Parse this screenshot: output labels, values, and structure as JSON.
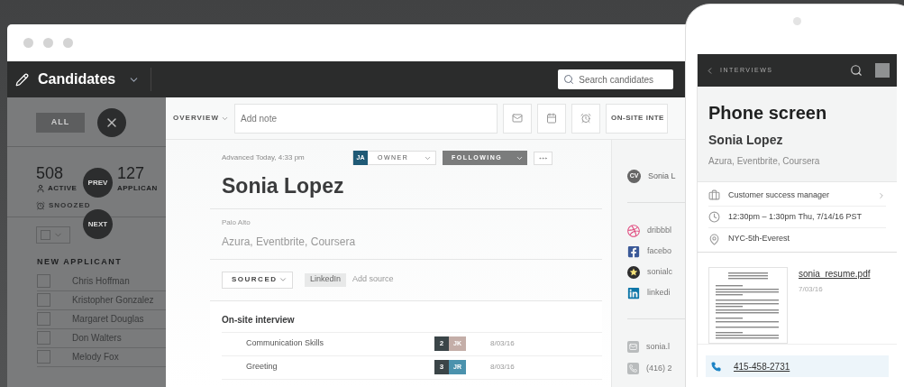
{
  "header": {
    "title": "Candidates",
    "search": {
      "placeholder": "Search candidates"
    }
  },
  "list_panel": {
    "filters": [
      {
        "label": "ALL",
        "selected": true
      }
    ],
    "stats": [
      {
        "count": "508",
        "label": "ACTIVE",
        "kind": "person"
      },
      {
        "count": "127",
        "label": "APPLICAN",
        "kind": "plain"
      }
    ],
    "snoozed": "SNOOZED",
    "section": "NEW APPLICANT",
    "candidates": [
      {
        "name": "Chris Hoffman",
        "checked": false
      },
      {
        "name": "Kristopher Gonzalez",
        "checked": false
      },
      {
        "name": "Margaret Douglas",
        "checked": false
      },
      {
        "name": "Don Walters",
        "checked": false
      },
      {
        "name": "Melody Fox",
        "checked": false
      }
    ]
  },
  "nav_controls": {
    "prev": "PREV",
    "next": "NEXT"
  },
  "toolbar": {
    "view": "OVERVIEW",
    "note": {
      "placeholder": "Add note"
    },
    "stage_button": "ON-SITE INTE"
  },
  "profile": {
    "advanced": "Advanced Today, 4:33 pm",
    "owner": {
      "initials": "JA",
      "label": "OWNER"
    },
    "follow": {
      "label": "FOLLOWING",
      "on": true
    },
    "name": "Sonia Lopez",
    "location": "Palo Alto",
    "companies": "Azura, Eventbrite, Coursera",
    "origin": "SOURCED",
    "source_tags": [
      "LinkedIn"
    ],
    "add_source": "Add source"
  },
  "feedback": {
    "title": "On-site interview",
    "rows": [
      {
        "name": "Communication Skills",
        "score": "2",
        "initials": "JK",
        "color": "#c4aea8",
        "date": "8/03/16"
      },
      {
        "name": "Greeting",
        "score": "3",
        "initials": "JR",
        "color": "#4b92ad",
        "date": "8/03/16"
      }
    ]
  },
  "contact": {
    "resume_badge": "CV",
    "resume": "Sonia L",
    "links": [
      {
        "kind": "dribbble",
        "text": "dribbbl"
      },
      {
        "kind": "facebook",
        "text": "facebo"
      },
      {
        "kind": "portfolio",
        "text": "sonialc"
      },
      {
        "kind": "linkedin",
        "text": "linkedi"
      }
    ],
    "email": "sonia.l",
    "phone": "(416) 2"
  },
  "phone": {
    "back": "INTERVIEWS",
    "title": "Phone screen",
    "name": "Sonia Lopez",
    "companies": "Azura, Eventbrite, Coursera",
    "details": [
      {
        "kind": "job",
        "text": "Customer success manager"
      },
      {
        "kind": "time",
        "text": "12:30pm – 1:30pm  Thu, 7/14/16 PST"
      },
      {
        "kind": "location",
        "text": "NYC-5th-Everest"
      }
    ],
    "file": {
      "name": "sonia_resume.pdf",
      "date": "7/03/16"
    },
    "call": "415-458-2731"
  }
}
